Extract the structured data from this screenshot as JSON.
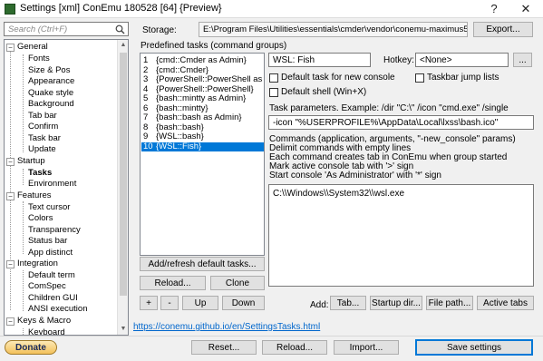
{
  "window": {
    "title": "Settings [xml] ConEmu 180528 [64] {Preview}",
    "help_glyph": "?",
    "close_glyph": "✕"
  },
  "search": {
    "placeholder": "Search (Ctrl+F)"
  },
  "storage": {
    "label": "Storage:",
    "path": "E:\\Program Files\\Utilities\\essentials\\cmder\\vendor\\conemu-maximus5\\ConEmu.xml",
    "export_label": "Export..."
  },
  "tree": {
    "groups": [
      {
        "label": "General",
        "expanded": true,
        "items": [
          "Fonts",
          "Size & Pos",
          "Appearance",
          "Quake style",
          "Background",
          "Tab bar",
          "Confirm",
          "Task bar",
          "Update"
        ]
      },
      {
        "label": "Startup",
        "expanded": true,
        "items": [
          "Tasks",
          "Environment"
        ]
      },
      {
        "label": "Features",
        "expanded": true,
        "items": [
          "Text cursor",
          "Colors",
          "Transparency",
          "Status bar",
          "App distinct"
        ]
      },
      {
        "label": "Integration",
        "expanded": true,
        "items": [
          "Default term",
          "ComSpec",
          "Children GUI",
          "ANSI execution"
        ]
      },
      {
        "label": "Keys & Macro",
        "expanded": true,
        "items": [
          "Keyboard"
        ]
      }
    ],
    "selected": "Tasks",
    "expander_glyph": "−"
  },
  "tasks": {
    "heading": "Predefined tasks (command groups)",
    "items": [
      {
        "num": "1",
        "name": "{cmd::Cmder as Admin}"
      },
      {
        "num": "2",
        "name": "{cmd::Cmder}"
      },
      {
        "num": "3",
        "name": "{PowerShell::PowerShell as Admin}"
      },
      {
        "num": "4",
        "name": "{PowerShell::PowerShell}"
      },
      {
        "num": "5",
        "name": "{bash::mintty as Admin}"
      },
      {
        "num": "6",
        "name": "{bash::mintty}"
      },
      {
        "num": "7",
        "name": "{bash::bash as Admin}"
      },
      {
        "num": "8",
        "name": "{bash::bash}"
      },
      {
        "num": "9",
        "name": "{WSL::bash}"
      },
      {
        "num": "10",
        "name": "{WSL::Fish}"
      }
    ],
    "selected_index": 9,
    "add_refresh_label": "Add/refresh default tasks...",
    "reload_label": "Reload...",
    "clone_label": "Clone",
    "plus_label": "+",
    "minus_label": "-",
    "up_label": "Up",
    "down_label": "Down"
  },
  "detail": {
    "task_name": "WSL: Fish",
    "hotkey_label": "Hotkey:",
    "hotkey_value": "<None>",
    "hotkey_btn": "...",
    "default_task_label": "Default task for new console",
    "jumplist_label": "Taskbar jump lists",
    "default_shell_label": "Default shell (Win+X)",
    "params_label": "Task parameters. Example: /dir \"C:\\\" /icon \"cmd.exe\" /single",
    "params_value": "-icon \"%USERPROFILE%\\AppData\\Local\\lxss\\bash.ico\"",
    "commands_help": [
      "Commands (application, arguments, \"-new_console\" params)",
      "Delimit commands with empty lines",
      "Each command creates tab in ConEmu when group started",
      "Mark active console tab with '>' sign",
      "Start console 'As Administrator' with '*' sign"
    ],
    "commands_value": "C:\\\\Windows\\\\System32\\\\wsl.exe",
    "add_label": "Add:",
    "tab_btn": "Tab...",
    "startup_btn": "Startup dir...",
    "filepath_btn": "File path...",
    "activetabs_btn": "Active tabs"
  },
  "footer": {
    "help_link": "https://conemu.github.io/en/SettingsTasks.html",
    "donate_label": "Donate",
    "reset_label": "Reset...",
    "reload_label": "Reload...",
    "import_label": "Import...",
    "save_label": "Save settings"
  },
  "colors": {
    "selection": "#0078d7",
    "link": "#0066cc"
  }
}
